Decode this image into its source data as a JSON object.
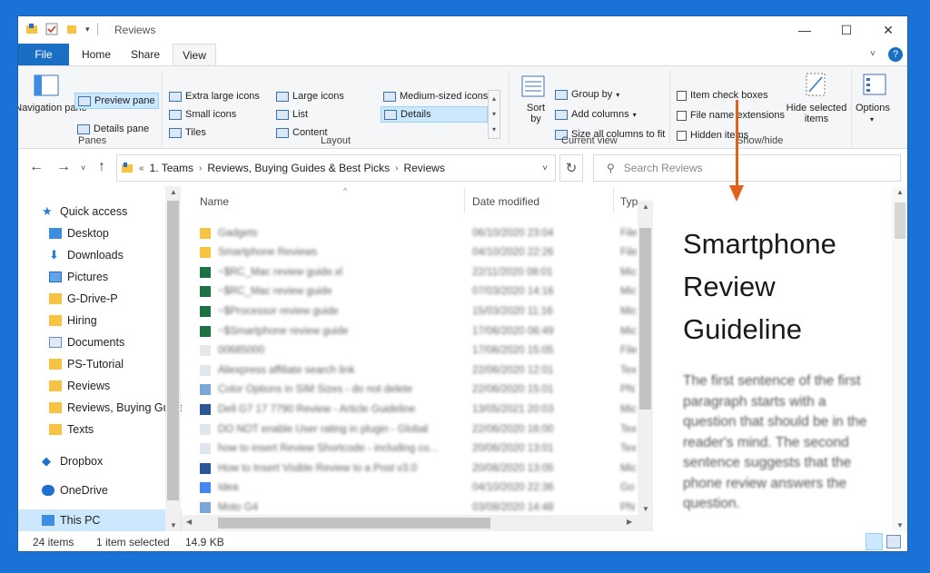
{
  "window": {
    "title": "Reviews",
    "minimize": "—",
    "maximize": "☐",
    "close": "✕",
    "help": "?"
  },
  "tabs": [
    "File",
    "Home",
    "Share",
    "View"
  ],
  "ribbon": {
    "panes": {
      "navigation_pane": "Navigation pane",
      "preview_pane": "Preview pane",
      "details_pane": "Details pane",
      "group_label": "Panes"
    },
    "layout": {
      "items": [
        "Extra large icons",
        "Large icons",
        "Medium-sized icons",
        "Small icons",
        "List",
        "Details",
        "Tiles",
        "Content"
      ],
      "group_label": "Layout"
    },
    "current_view": {
      "sort_by": "Sort by",
      "group_by": "Group by",
      "add_columns": "Add columns",
      "size_all_columns": "Size all columns to fit",
      "group_label": "Current view"
    },
    "show_hide": {
      "item_check_boxes": "Item check boxes",
      "file_name_extensions": "File name extensions",
      "hidden_items": "Hidden items",
      "hide_selected_items": "Hide selected items",
      "group_label": "Show/hide"
    },
    "options": "Options"
  },
  "address": {
    "crumbs": [
      "1. Teams",
      "Reviews, Buying Guides & Best Picks",
      "Reviews"
    ],
    "search_placeholder": "Search Reviews"
  },
  "nav": {
    "items": [
      {
        "label": "Quick access"
      },
      {
        "label": "Desktop"
      },
      {
        "label": "Downloads"
      },
      {
        "label": "Pictures"
      },
      {
        "label": "G-Drive-P"
      },
      {
        "label": "Hiring"
      },
      {
        "label": "Documents"
      },
      {
        "label": "PS-Tutorial"
      },
      {
        "label": "Reviews"
      },
      {
        "label": "Reviews, Buying Guides & Best Picks"
      },
      {
        "label": "Texts"
      },
      {
        "label": "Dropbox"
      },
      {
        "label": "OneDrive"
      },
      {
        "label": "This PC"
      }
    ]
  },
  "filelist": {
    "columns": [
      "Name",
      "Date modified",
      "Typ"
    ],
    "rows": [
      {
        "name": "Gadgets",
        "date": "06/10/2020 23:04",
        "type": "File",
        "kind": "folder"
      },
      {
        "name": "Smartphone Reviews",
        "date": "04/10/2020 22:26",
        "type": "File",
        "kind": "folder"
      },
      {
        "name": "~$RC_Mac review guide.xl",
        "date": "22/11/2020 08:01",
        "type": "Mic",
        "kind": "excel"
      },
      {
        "name": "~$RC_Mac review guide",
        "date": "07/03/2020 14:16",
        "type": "Mic",
        "kind": "excel"
      },
      {
        "name": "~$Processor review guide",
        "date": "15/03/2020 11:16",
        "type": "Mic",
        "kind": "excel"
      },
      {
        "name": "~$Smartphone review guide",
        "date": "17/06/2020 06:49",
        "type": "Mic",
        "kind": "excel"
      },
      {
        "name": "00685000",
        "date": "17/06/2020 15:05",
        "type": "File",
        "kind": "blank"
      },
      {
        "name": "Aliexpress affiliate search link",
        "date": "22/06/2020 12:01",
        "type": "Tex",
        "kind": "text"
      },
      {
        "name": "Color Options in SIM Sizes - do not delete",
        "date": "22/06/2020 15:01",
        "type": "PN",
        "kind": "image"
      },
      {
        "name": "Dell G7 17 7790 Review - Article Guideline",
        "date": "13/05/2021 20:03",
        "type": "Mic",
        "kind": "word"
      },
      {
        "name": "DO NOT enable User rating in plugin - Global",
        "date": "22/06/2020 16:00",
        "type": "Tex",
        "kind": "text"
      },
      {
        "name": "how to insert Review Shortcode - including co...",
        "date": "20/06/2020 13:01",
        "type": "Tex",
        "kind": "text"
      },
      {
        "name": "How to Insert Visible Review to a Post v3.0",
        "date": "20/06/2020 13:05",
        "type": "Mic",
        "kind": "word"
      },
      {
        "name": "Idea",
        "date": "04/10/2020 22:36",
        "type": "Go",
        "kind": "doc"
      },
      {
        "name": "Moto G4",
        "date": "03/08/2020 14:48",
        "type": "PN",
        "kind": "image"
      }
    ]
  },
  "preview": {
    "title": "Smartphone Review Guideline",
    "body": "The first sentence of the first paragraph starts with a question that should be in the reader's mind. The second sentence suggests that the phone review answers the question."
  },
  "status": {
    "count": "24 items",
    "selected": "1 item selected",
    "size": "14.9 KB"
  },
  "colors": {
    "accent": "#1a6fc4",
    "selection": "#cce8ff",
    "annotation_arrow": "#e0621d"
  }
}
